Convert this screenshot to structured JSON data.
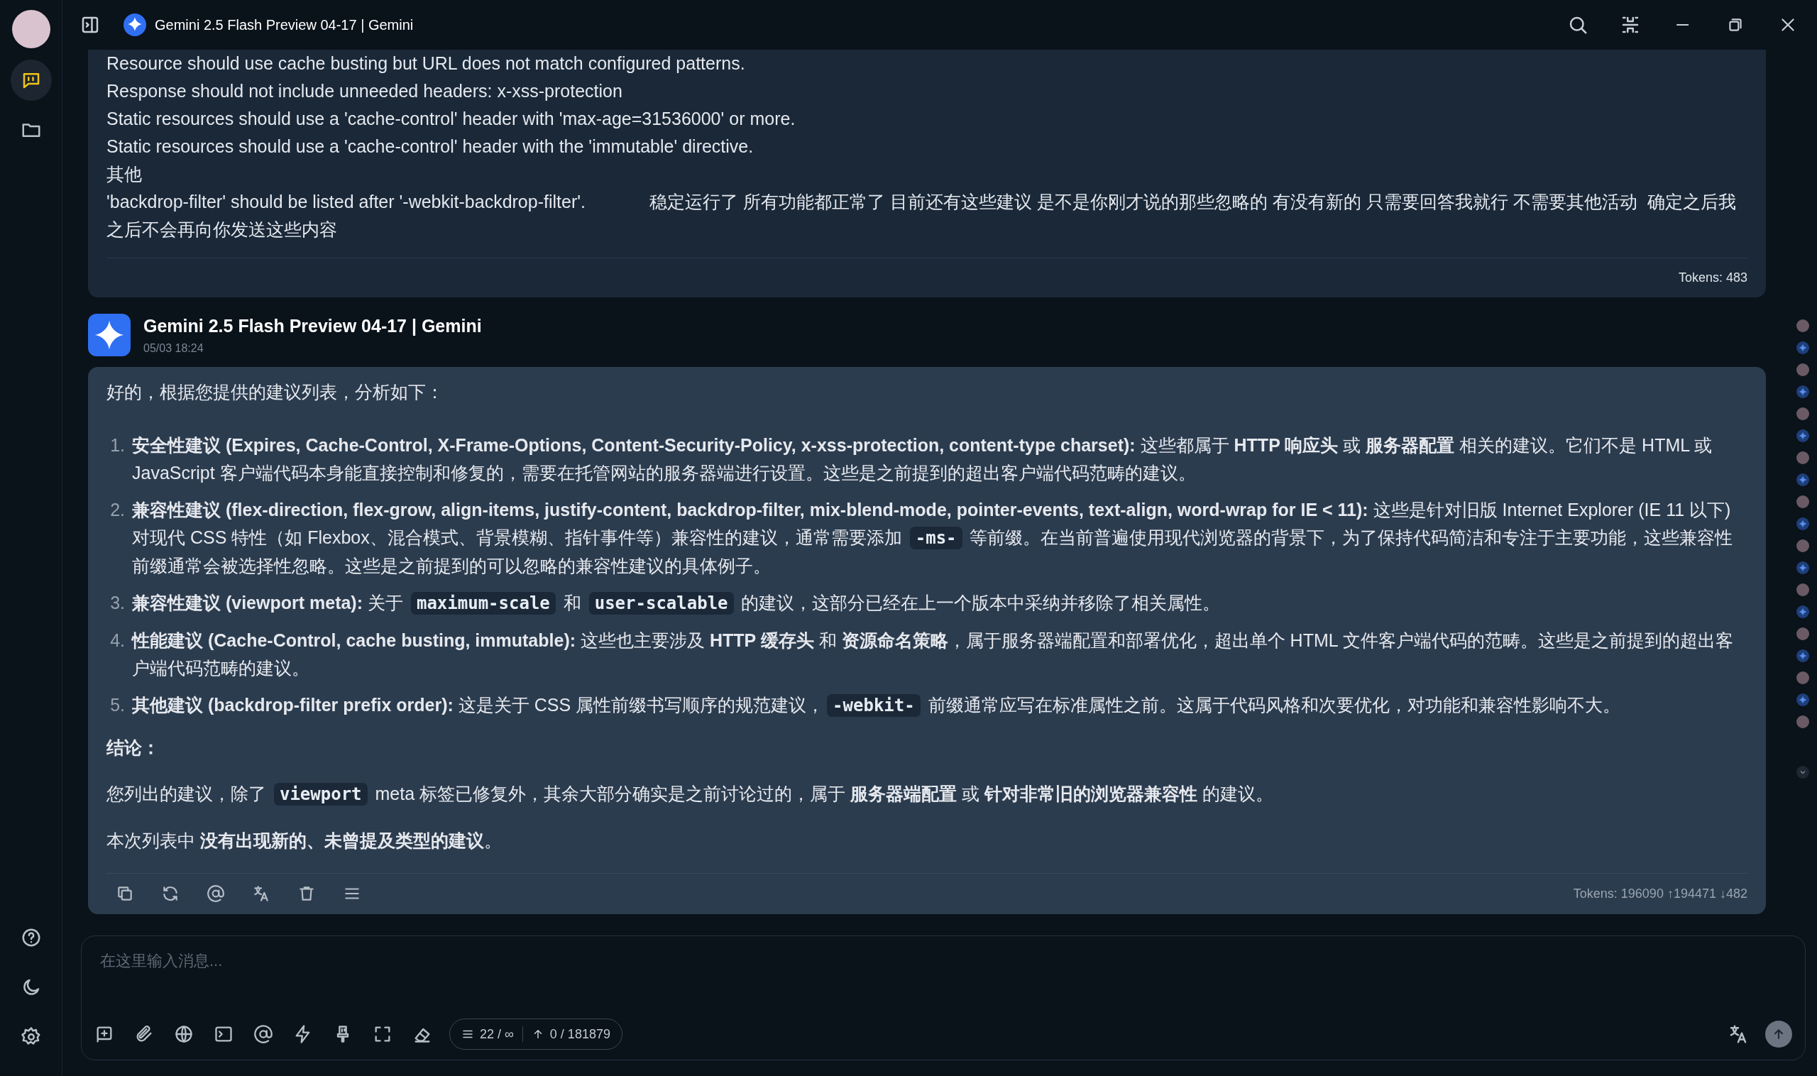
{
  "window": {
    "title": "Gemini 2.5 Flash Preview 04-17 | Gemini"
  },
  "sidebar": {
    "items": [
      {
        "kind": "chat",
        "selected": true
      },
      {
        "kind": "folder",
        "selected": false
      }
    ]
  },
  "previous_message": {
    "lines": [
      "Resource should use cache busting but URL does not match configured patterns.",
      "Response should not include unneeded headers: x-xss-protection",
      "Static resources should use a 'cache-control' header with 'max-age=31536000' or more.",
      "Static resources should use a 'cache-control' header with the 'immutable' directive.",
      "其他",
      "'backdrop-filter' should be listed after '-webkit-backdrop-filter'.             稳定运行了 所有功能都正常了 目前还有这些建议 是不是你刚才说的那些忽略的 有没有新的 只需要回答我就行 不需要其他活动  确定之后我之后不会再向你发送这些内容"
    ],
    "tokens": "Tokens: 483"
  },
  "message": {
    "sender": "Gemini 2.5 Flash Preview 04-17 | Gemini",
    "time": "05/03 18:24",
    "blocks": [
      {
        "kind": "paragraph",
        "segments": [
          {
            "kind": "text",
            "text": "好的，根据您提供的建议列表，分析如下："
          }
        ]
      },
      {
        "kind": "list",
        "items": [
          {
            "number": "1.",
            "segments": [
              {
                "kind": "text",
                "text": "**安全性建议 (Expires, Cache-Control, X-Frame-Options, Content-Security-Policy, x-xss-protection, content-type charset):** 这些都属于 **HTTP 响应头** 或 **服务器配置** 相关的建议。它们不是 HTML 或 JavaScript 客户端代码本身能直接控制和修复的，需要在托管网站的服务器端进行设置。这些是之前提到的超出客户端代码范畴的建议。"
              }
            ]
          },
          {
            "number": "2.",
            "segments": [
              {
                "kind": "text",
                "text": "**兼容性建议 (flex-direction, flex-grow, align-items, justify-content, backdrop-filter, mix-blend-mode, pointer-events, text-align, word-wrap for IE < 11):** 这些是针对旧版 Internet Explorer (IE 11 以下) 对现代 CSS 特性（如 Flexbox、混合模式、背景模糊、指针事件等）兼容性的建议，通常需要添加 "
              },
              {
                "kind": "code",
                "text": "-ms-"
              },
              {
                "kind": "text",
                "text": " 等前缀。在当前普遍使用现代浏览器的背景下，为了保持代码简洁和专注于主要功能，这些兼容性前缀通常会被选择性忽略。这些是之前提到的可以忽略的兼容性建议的具体例子。"
              }
            ]
          },
          {
            "number": "3.",
            "segments": [
              {
                "kind": "text",
                "text": "**兼容性建议 (viewport meta):** 关于 "
              },
              {
                "kind": "code",
                "text": "maximum-scale"
              },
              {
                "kind": "text",
                "text": " 和 "
              },
              {
                "kind": "code",
                "text": "user-scalable"
              },
              {
                "kind": "text",
                "text": " 的建议，这部分已经在上一个版本中采纳并移除了相关属性。"
              }
            ]
          },
          {
            "number": "4.",
            "segments": [
              {
                "kind": "text",
                "text": "**性能建议 (Cache-Control, cache busting, immutable):** 这些也主要涉及 **HTTP 缓存头** 和 **资源命名策略**，属于服务器端配置和部署优化，超出单个 HTML 文件客户端代码的范畴。这些是之前提到的超出客户端代码范畴的建议。"
              }
            ]
          },
          {
            "number": "5.",
            "segments": [
              {
                "kind": "text",
                "text": "**其他建议 (backdrop-filter prefix order):** 这是关于 CSS 属性前缀书写顺序的规范建议，"
              },
              {
                "kind": "code",
                "text": "-webkit-"
              },
              {
                "kind": "text",
                "text": " 前缀通常应写在标准属性之前。这属于代码风格和次要优化，对功能和兼容性影响不大。"
              }
            ]
          }
        ]
      },
      {
        "kind": "heading",
        "text": "结论："
      },
      {
        "kind": "paragraph",
        "segments": [
          {
            "kind": "text",
            "text": "您列出的建议，除了 "
          },
          {
            "kind": "code",
            "text": "viewport"
          },
          {
            "kind": "text",
            "text": " meta 标签已修复外，其余大部分确实是之前讨论过的，属于 **服务器端配置** 或 **针对非常旧的浏览器兼容性** 的建议。"
          }
        ]
      },
      {
        "kind": "paragraph",
        "segments": [
          {
            "kind": "text",
            "text": "本次列表中 **没有出现新的、未曾提及类型的建议**。"
          }
        ]
      }
    ],
    "tokens": "Tokens: 196090 ↑194471 ↓482"
  },
  "scroll_markers": [
    {
      "kind": "user"
    },
    {
      "kind": "assistant"
    },
    {
      "kind": "user"
    },
    {
      "kind": "assistant"
    },
    {
      "kind": "user"
    },
    {
      "kind": "assistant"
    },
    {
      "kind": "user"
    },
    {
      "kind": "assistant"
    },
    {
      "kind": "user"
    },
    {
      "kind": "assistant"
    },
    {
      "kind": "user"
    },
    {
      "kind": "assistant"
    },
    {
      "kind": "user"
    },
    {
      "kind": "assistant"
    },
    {
      "kind": "user"
    },
    {
      "kind": "assistant"
    },
    {
      "kind": "user"
    },
    {
      "kind": "assistant"
    },
    {
      "kind": "user"
    }
  ],
  "composer": {
    "placeholder": "在这里输入消息...",
    "context": "22 / ∞",
    "usage": "0 / 181879"
  }
}
